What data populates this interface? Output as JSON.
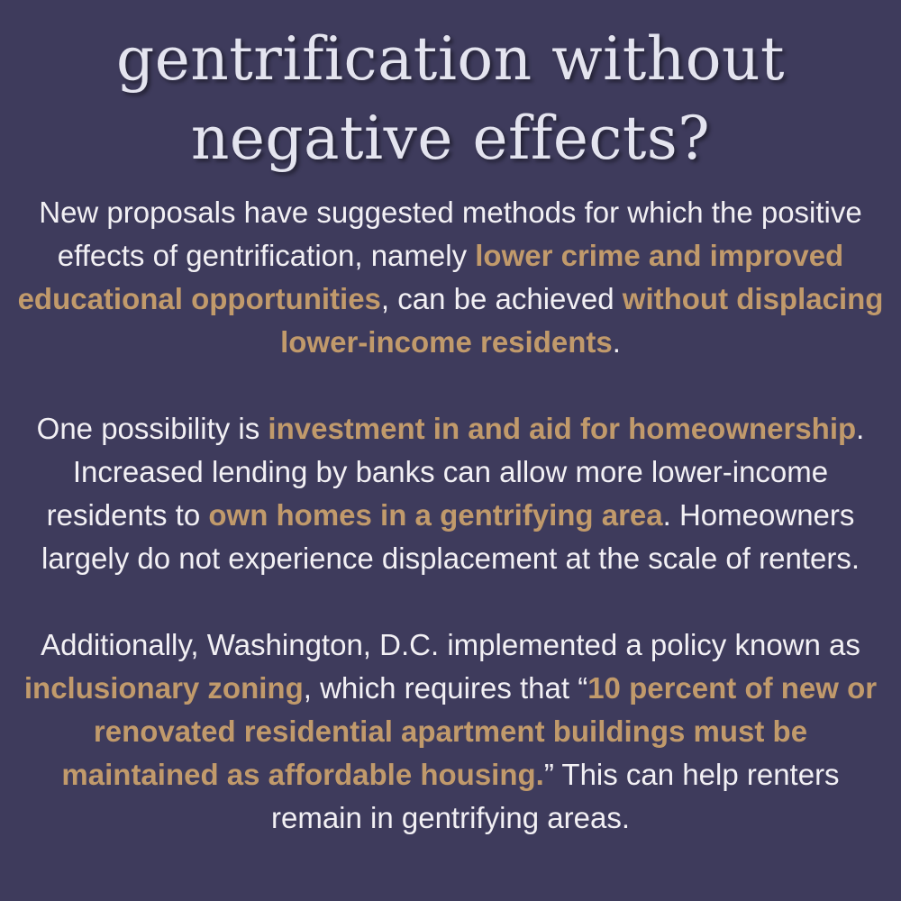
{
  "colors": {
    "background": "#3e3b5c",
    "title": "#e4e4ef",
    "body_text": "#f2f0f4",
    "highlight": "#c19a6b"
  },
  "title": "gentrification without negative effects?",
  "paragraph1": {
    "t1": "New proposals have suggested methods for which the positive effects of gentrification, namely ",
    "h1": "lower crime and improved educational opportunities",
    "t2": ", can be achieved ",
    "h2": "without displacing lower-income residents",
    "t3": "."
  },
  "paragraph2": {
    "t1": "One possibility is ",
    "h1": "investment in and aid for homeownership",
    "t2": ". Increased lending by banks can allow more lower-income residents to ",
    "h2": "own homes in a gentrifying area",
    "t3": ". Homeowners largely do not experience displacement at the scale of renters."
  },
  "paragraph3": {
    "t1": "Additionally, Washington, D.C. implemented a policy known as ",
    "h1": "inclusionary zoning",
    "t2": ", which requires that “",
    "h2": "10 percent of new or renovated residential apartment buildings must be maintained as affordable housing.",
    "t3": "” This can help renters remain in gentrifying areas."
  }
}
